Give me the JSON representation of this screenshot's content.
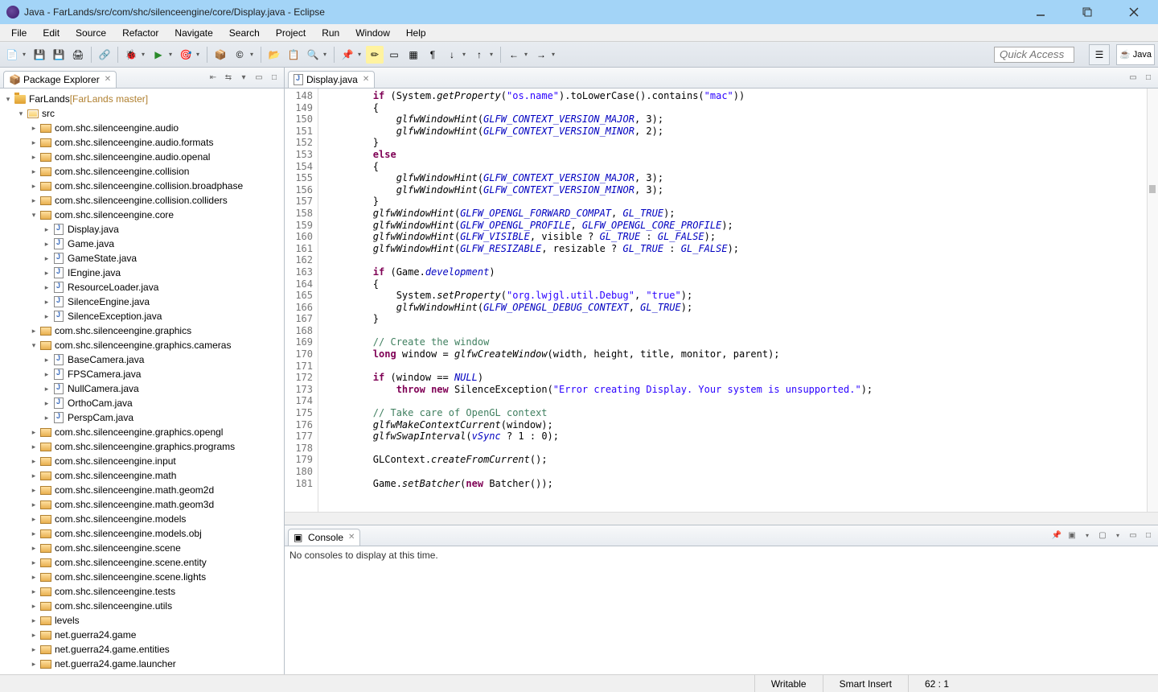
{
  "window": {
    "title": "Java - FarLands/src/com/shc/silenceengine/core/Display.java - Eclipse"
  },
  "menu": [
    "File",
    "Edit",
    "Source",
    "Refactor",
    "Navigate",
    "Search",
    "Project",
    "Run",
    "Window",
    "Help"
  ],
  "quick_access_placeholder": "Quick Access",
  "perspective_label": "Java",
  "package_explorer": {
    "title": "Package Explorer",
    "project": "FarLands",
    "project_repo": "[FarLands master]",
    "src_label": "src",
    "packages_top": [
      "com.shc.silenceengine.audio",
      "com.shc.silenceengine.audio.formats",
      "com.shc.silenceengine.audio.openal",
      "com.shc.silenceengine.collision",
      "com.shc.silenceengine.collision.broadphase",
      "com.shc.silenceengine.collision.colliders"
    ],
    "core_pkg": "com.shc.silenceengine.core",
    "core_files": [
      "Display.java",
      "Game.java",
      "GameState.java",
      "IEngine.java",
      "ResourceLoader.java",
      "SilenceEngine.java",
      "SilenceException.java"
    ],
    "graphics_pkg": "com.shc.silenceengine.graphics",
    "cameras_pkg": "com.shc.silenceengine.graphics.cameras",
    "camera_files": [
      "BaseCamera.java",
      "FPSCamera.java",
      "NullCamera.java",
      "OrthoCam.java",
      "PerspCam.java"
    ],
    "packages_rest": [
      "com.shc.silenceengine.graphics.opengl",
      "com.shc.silenceengine.graphics.programs",
      "com.shc.silenceengine.input",
      "com.shc.silenceengine.math",
      "com.shc.silenceengine.math.geom2d",
      "com.shc.silenceengine.math.geom3d",
      "com.shc.silenceengine.models",
      "com.shc.silenceengine.models.obj",
      "com.shc.silenceengine.scene",
      "com.shc.silenceengine.scene.entity",
      "com.shc.silenceengine.scene.lights",
      "com.shc.silenceengine.tests",
      "com.shc.silenceengine.utils",
      "levels",
      "net.guerra24.game",
      "net.guerra24.game.entities",
      "net.guerra24.game.launcher"
    ]
  },
  "editor": {
    "tab_label": "Display.java",
    "line_start": 148,
    "line_end": 181,
    "code": [
      {
        "t": "        <kw>if</kw> (System.<call>getProperty</call>(<str>\"os.name\"</str>).toLowerCase().contains(<str>\"mac\"</str>))"
      },
      {
        "t": "        {"
      },
      {
        "t": "            <call>glfwWindowHint</call>(<const>GLFW_CONTEXT_VERSION_MAJOR</const>, 3);"
      },
      {
        "t": "            <call>glfwWindowHint</call>(<const>GLFW_CONTEXT_VERSION_MINOR</const>, 2);"
      },
      {
        "t": "        }"
      },
      {
        "t": "        <kw>else</kw>"
      },
      {
        "t": "        {"
      },
      {
        "t": "            <call>glfwWindowHint</call>(<const>GLFW_CONTEXT_VERSION_MAJOR</const>, 3);"
      },
      {
        "t": "            <call>glfwWindowHint</call>(<const>GLFW_CONTEXT_VERSION_MINOR</const>, 3);"
      },
      {
        "t": "        }"
      },
      {
        "t": "        <call>glfwWindowHint</call>(<const>GLFW_OPENGL_FORWARD_COMPAT</const>, <const>GL_TRUE</const>);"
      },
      {
        "t": "        <call>glfwWindowHint</call>(<const>GLFW_OPENGL_PROFILE</const>, <const>GLFW_OPENGL_CORE_PROFILE</const>);"
      },
      {
        "t": "        <call>glfwWindowHint</call>(<const>GLFW_VISIBLE</const>, visible ? <const>GL_TRUE</const> : <const>GL_FALSE</const>);"
      },
      {
        "t": "        <call>glfwWindowHint</call>(<const>GLFW_RESIZABLE</const>, resizable ? <const>GL_TRUE</const> : <const>GL_FALSE</const>);"
      },
      {
        "t": ""
      },
      {
        "t": "        <kw>if</kw> (Game.<const>development</const>)"
      },
      {
        "t": "        {"
      },
      {
        "t": "            System.<call>setProperty</call>(<str>\"org.lwjgl.util.Debug\"</str>, <str>\"true\"</str>);"
      },
      {
        "t": "            <call>glfwWindowHint</call>(<const>GLFW_OPENGL_DEBUG_CONTEXT</const>, <const>GL_TRUE</const>);"
      },
      {
        "t": "        }"
      },
      {
        "t": ""
      },
      {
        "t": "        <com>// Create the window</com>"
      },
      {
        "t": "        <kw>long</kw> window = <call>glfwCreateWindow</call>(width, height, title, monitor, parent);"
      },
      {
        "t": ""
      },
      {
        "t": "        <kw>if</kw> (window == <const>NULL</const>)"
      },
      {
        "t": "            <kw>throw</kw> <kw>new</kw> SilenceException(<str>\"Error creating Display. Your system is unsupported.\"</str>);"
      },
      {
        "t": ""
      },
      {
        "t": "        <com>// Take care of OpenGL context</com>"
      },
      {
        "t": "        <call>glfwMakeContextCurrent</call>(window);"
      },
      {
        "t": "        <call>glfwSwapInterval</call>(<const>vSync</const> ? 1 : 0);"
      },
      {
        "t": ""
      },
      {
        "t": "        GLContext.<call>createFromCurrent</call>();"
      },
      {
        "t": ""
      },
      {
        "t": "        Game.<call>setBatcher</call>(<kw>new</kw> Batcher());"
      }
    ]
  },
  "console": {
    "title": "Console",
    "body": "No consoles to display at this time."
  },
  "status": {
    "writable": "Writable",
    "insert": "Smart Insert",
    "cursor": "62 : 1"
  }
}
